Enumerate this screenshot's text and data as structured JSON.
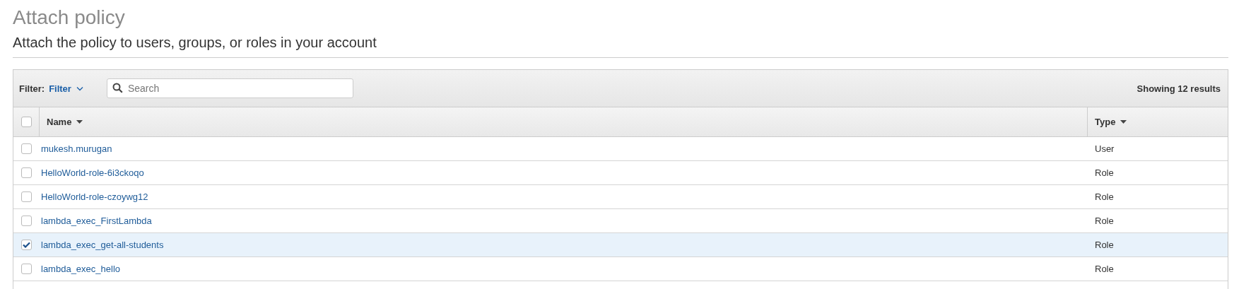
{
  "title": "Attach policy",
  "subtitle": "Attach the policy to users, groups, or roles in your account",
  "filter": {
    "label": "Filter:",
    "value": "Filter"
  },
  "search": {
    "placeholder": "Search"
  },
  "result_count": "Showing 12 results",
  "table": {
    "select_all": {
      "checked": false
    },
    "columns": [
      "Name",
      "Type"
    ],
    "rows": [
      {
        "name": "mukesh.murugan",
        "type": "User",
        "selected": false
      },
      {
        "name": "HelloWorld-role-6i3ckoqo",
        "type": "Role",
        "selected": false
      },
      {
        "name": "HelloWorld-role-czoywg12",
        "type": "Role",
        "selected": false
      },
      {
        "name": "lambda_exec_FirstLambda",
        "type": "Role",
        "selected": false
      },
      {
        "name": "lambda_exec_get-all-students",
        "type": "Role",
        "selected": true
      },
      {
        "name": "lambda_exec_hello",
        "type": "Role",
        "selected": false
      }
    ]
  }
}
